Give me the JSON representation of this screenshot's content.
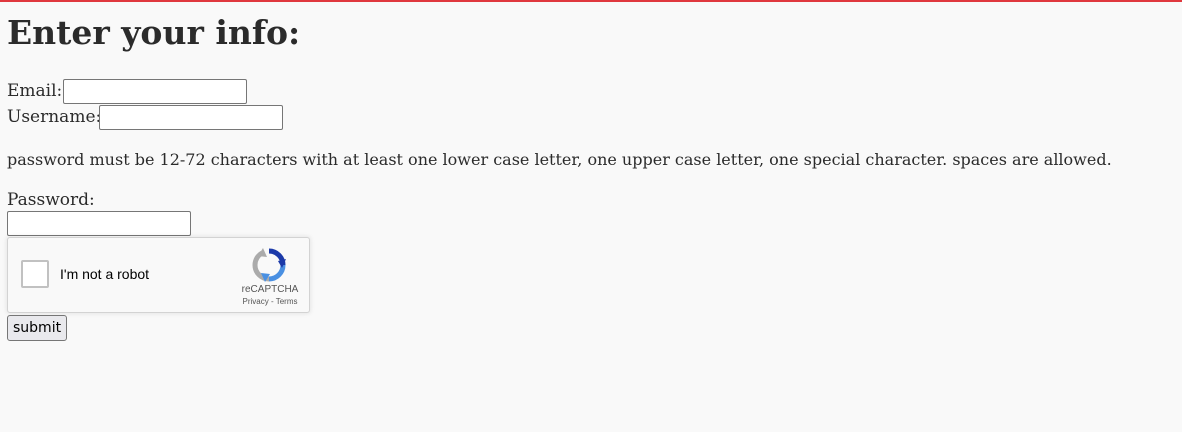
{
  "page": {
    "title": "Enter your info:"
  },
  "form": {
    "email_label": "Email:",
    "email_value": "",
    "username_label": "Username:",
    "username_value": "",
    "password_note": "password must be 12-72 characters with at least one lower case letter, one upper case letter, one special character. spaces are allowed.",
    "password_label": "Password:",
    "password_value": "",
    "submit_label": "submit"
  },
  "captcha": {
    "label": "I'm not a robot",
    "brand": "reCAPTCHA",
    "privacy": "Privacy",
    "separator": "-",
    "terms": "Terms",
    "checked": false
  },
  "colors": {
    "accent_line": "#e0383e",
    "background": "#f9f9f9"
  }
}
